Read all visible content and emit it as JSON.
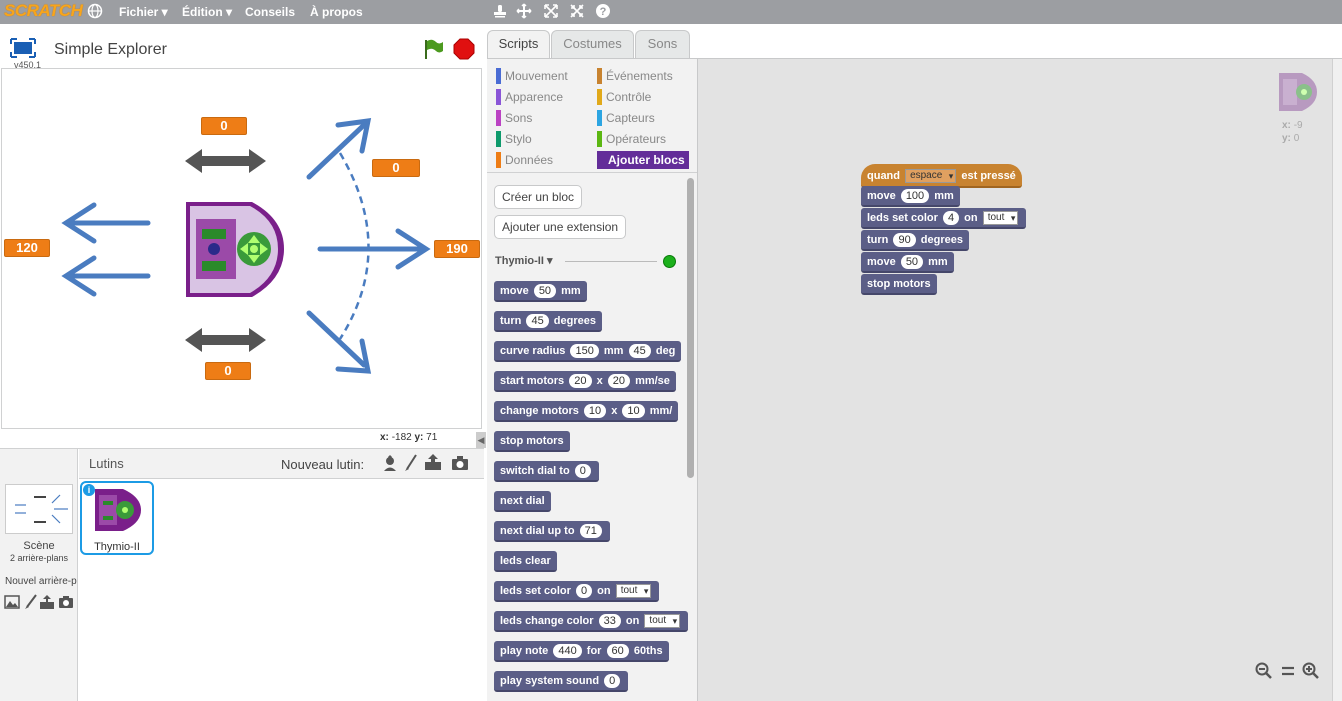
{
  "menubar": {
    "logo": "SCRATCH",
    "items": [
      "Fichier ▾",
      "Édition ▾",
      "Conseils",
      "À propos"
    ]
  },
  "stage": {
    "project_title": "Simple Explorer",
    "version": "v450.1",
    "coords": {
      "x_label": "x:",
      "x_value": "-182",
      "y_label": "y:",
      "y_value": "71"
    },
    "monitors": {
      "top": "0",
      "bottom": "0",
      "left": "120",
      "right": "190",
      "curve": "0"
    }
  },
  "tabs": [
    "Scripts",
    "Costumes",
    "Sons"
  ],
  "categories": [
    {
      "label": "Mouvement",
      "color": "#4a6cd4"
    },
    {
      "label": "Événements",
      "color": "#c88330"
    },
    {
      "label": "Apparence",
      "color": "#8a55d7"
    },
    {
      "label": "Contrôle",
      "color": "#e1a91a"
    },
    {
      "label": "Sons",
      "color": "#bb42c3"
    },
    {
      "label": "Capteurs",
      "color": "#2ca5e2"
    },
    {
      "label": "Stylo",
      "color": "#0e9a6c"
    },
    {
      "label": "Opérateurs",
      "color": "#5cb712"
    },
    {
      "label": "Données",
      "color": "#ee7d16"
    },
    {
      "label": "Ajouter blocs",
      "color": "#632d99"
    }
  ],
  "palette": {
    "create_block": "Créer un bloc",
    "add_extension": "Ajouter une extension",
    "extension_name": "Thymio-II",
    "blocks": [
      {
        "t1": "move",
        "v1": "50",
        "t2": "mm"
      },
      {
        "t1": "turn",
        "v1": "45",
        "t2": "degrees"
      },
      {
        "t1": "curve radius",
        "v1": "150",
        "t2": "mm",
        "v2": "45",
        "t3": "deg"
      },
      {
        "t1": "start motors",
        "v1": "20",
        "t2": "x",
        "v2": "20",
        "t3": "mm/se"
      },
      {
        "t1": "change motors",
        "v1": "10",
        "t2": "x",
        "v2": "10",
        "t3": "mm/"
      },
      {
        "t1": "stop motors"
      },
      {
        "t1": "switch dial to",
        "v1": "0"
      },
      {
        "t1": "next dial"
      },
      {
        "t1": "next dial up to",
        "v1": "71"
      },
      {
        "t1": "leds clear"
      },
      {
        "t1": "leds set color",
        "v1": "0",
        "t2": "on",
        "d1": "tout"
      },
      {
        "t1": "leds change color",
        "v1": "33",
        "t2": "on",
        "d1": "tout"
      },
      {
        "t1": "play note",
        "v1": "440",
        "t2": "for",
        "v2": "60",
        "t3": "60ths"
      },
      {
        "t1": "play system sound",
        "v1": "0"
      }
    ]
  },
  "script": {
    "hat": {
      "t1": "quand",
      "d1": "espace",
      "t2": "est pressé"
    },
    "blocks": [
      {
        "t1": "move",
        "v1": "100",
        "t2": "mm"
      },
      {
        "t1": "leds set color",
        "v1": "4",
        "t2": "on",
        "d1": "tout"
      },
      {
        "t1": "turn",
        "v1": "90",
        "t2": "degrees"
      },
      {
        "t1": "move",
        "v1": "50",
        "t2": "mm"
      },
      {
        "t1": "stop motors"
      }
    ]
  },
  "sprite_info": {
    "x_label": "x:",
    "x_value": "-9",
    "y_label": "y:",
    "y_value": "0"
  },
  "sprites": {
    "title": "Lutins",
    "new_sprite": "Nouveau lutin:",
    "scene_label": "Scène",
    "scene_sub": "2 arrière-plans",
    "new_backdrop": "Nouvel arrière-p",
    "sprite_name": "Thymio-II"
  }
}
